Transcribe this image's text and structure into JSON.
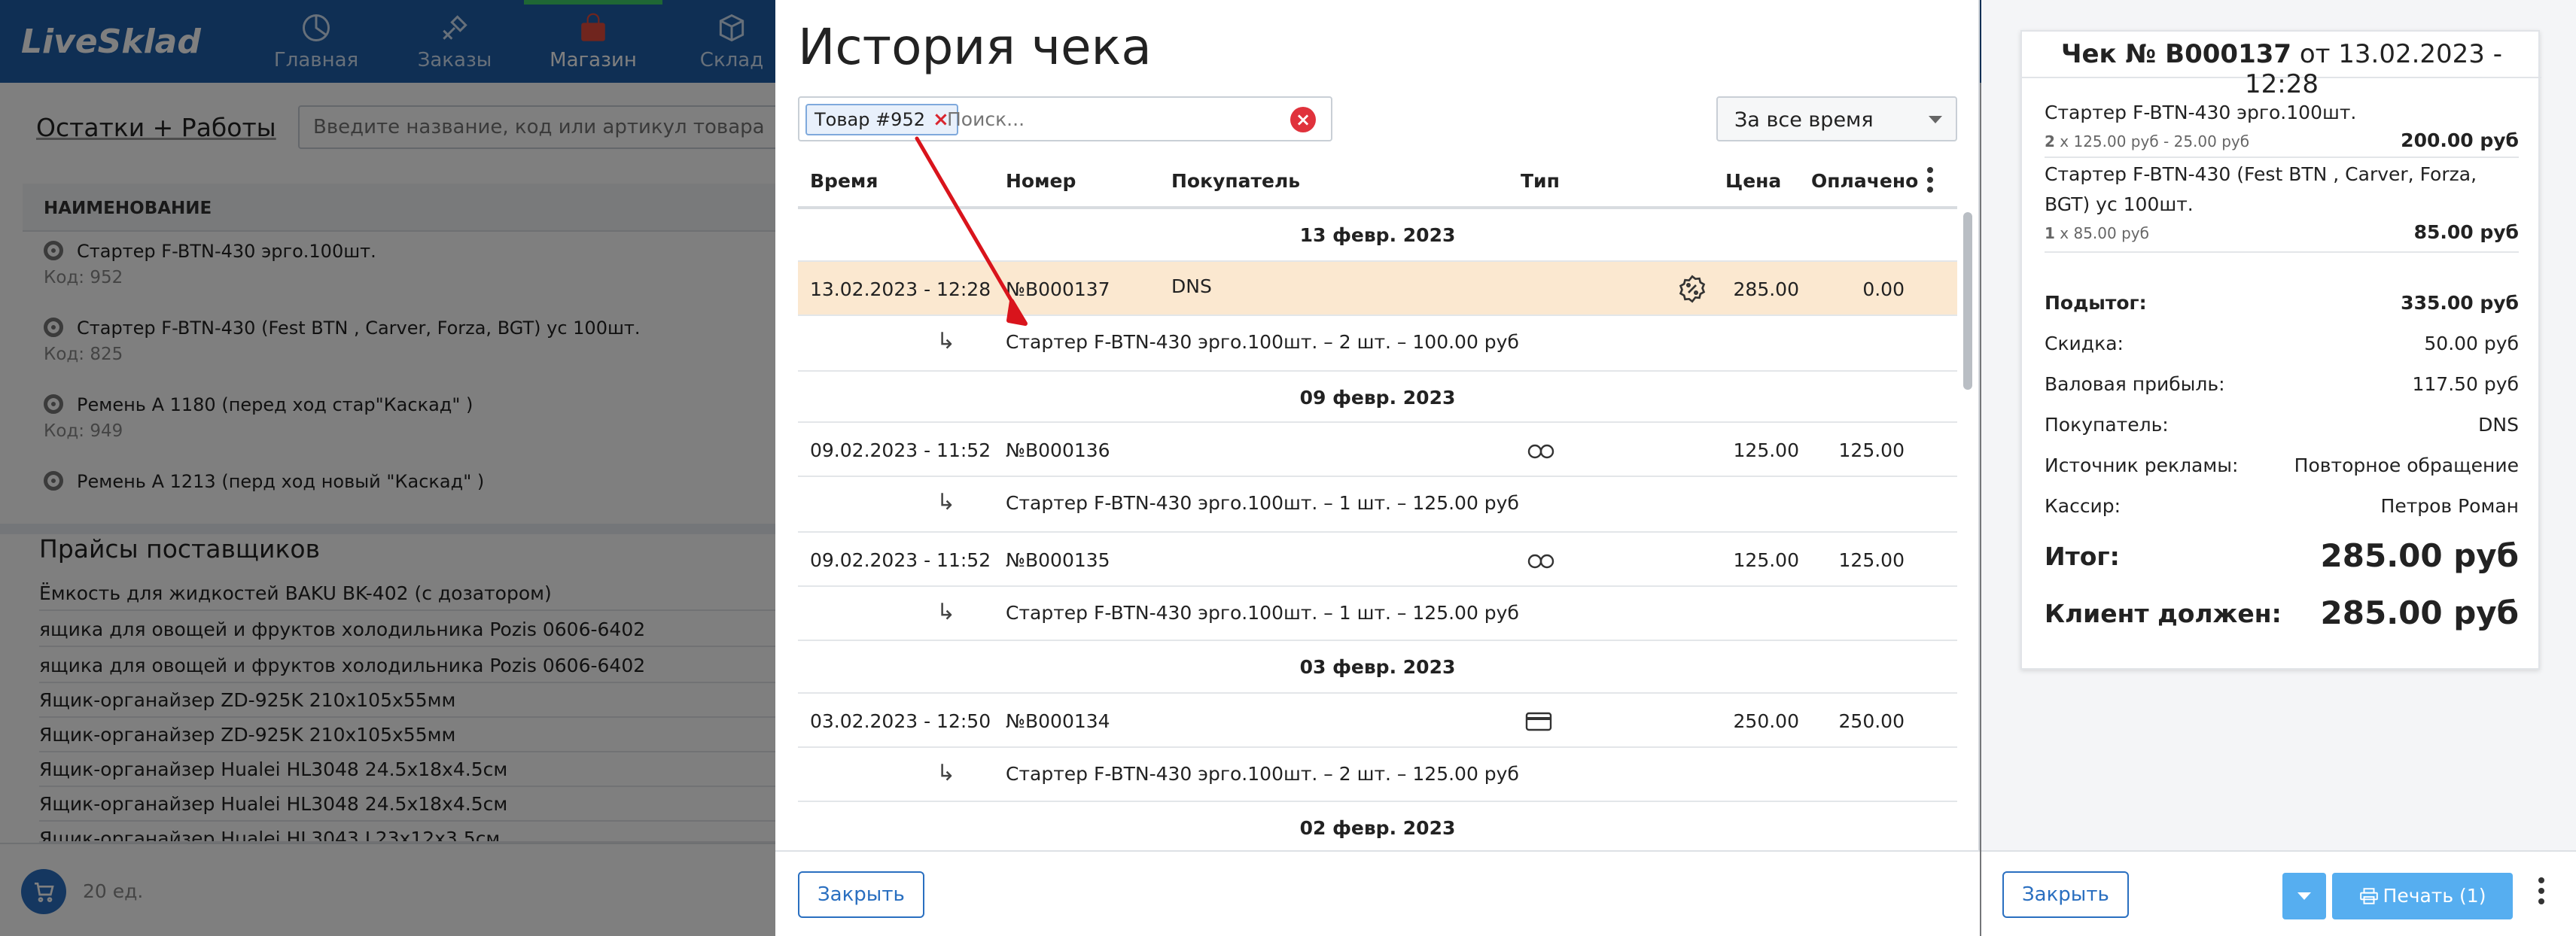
{
  "app": {
    "logo": "LiveSklad",
    "nav": [
      {
        "label": "Главная",
        "icon": "pie-chart-icon"
      },
      {
        "label": "Заказы",
        "icon": "tools-icon"
      },
      {
        "label": "Магазин",
        "icon": "shopping-bag-icon"
      },
      {
        "label": "Склад",
        "icon": "box-icon"
      }
    ]
  },
  "left_panel": {
    "section_title": "Остатки + Работы",
    "search_placeholder": "Введите название, код или артикул товара",
    "column_header": "НАИМЕНОВАНИЕ",
    "items": [
      {
        "name": "Стартер F-BTN-430 эрго.100шт.",
        "code": "Код: 952"
      },
      {
        "name": "Стартер F-BTN-430 (Fest BTN , Carver, Forza, BGT) ус 100шт.",
        "code": "Код: 825"
      },
      {
        "name": "Ремень А 1180 (перед ход стар\"Каскад\" )",
        "code": "Код: 949"
      },
      {
        "name": "Ремень А 1213 (перд ход новый \"Каскад\" )",
        "code": ""
      }
    ],
    "price_title": "Прайсы поставщиков",
    "price_rows": [
      "Ёмкость для жидкостей BAKU BK-402 (с дозатором)",
      "ящика для овощей и фруктов холодильника Pozis 0606-6402",
      "ящика для овощей и фруктов холодильника Pozis 0606-6402",
      "Ящик-органайзер ZD-925K 210x105x55мм",
      "Ящик-органайзер ZD-925K 210x105x55мм",
      "Ящик-органайзер Hualei HL3048 24.5x18x4.5см",
      "Ящик-органайзер Hualei HL3048 24.5x18x4.5см",
      "Ящик-органайзер Hualei HL3043 L23x12x3.5см"
    ],
    "cart_count": "20 ед."
  },
  "history": {
    "title": "История чека",
    "tag_label": "Товар #952",
    "search_placeholder": "Поиск...",
    "period": "За все время",
    "columns": {
      "time": "Время",
      "number": "Номер",
      "buyer": "Покупатель",
      "type": "Тип",
      "price": "Цена",
      "paid": "Оплачено"
    },
    "groups": [
      {
        "date": "13 февр. 2023",
        "time": "13.02.2023 - 12:28",
        "number": "№B000137",
        "buyer": "DNS",
        "type_icon": "discount-icon",
        "price": "285.00",
        "paid": "0.00",
        "detail": "Стартер F-BTN-430 эрго.100шт. – 2 шт. – 100.00 руб"
      },
      {
        "date": "09 февр. 2023",
        "time": "09.02.2023 - 11:52",
        "number": "№B000136",
        "buyer": "",
        "type_icon": "cash-icon",
        "price": "125.00",
        "paid": "125.00",
        "detail": "Стартер F-BTN-430 эрго.100шт. – 1 шт. – 125.00 руб"
      },
      {
        "date": "",
        "time": "09.02.2023 - 11:52",
        "number": "№B000135",
        "buyer": "",
        "type_icon": "cash-icon",
        "price": "125.00",
        "paid": "125.00",
        "detail": "Стартер F-BTN-430 эрго.100шт. – 1 шт. – 125.00 руб"
      },
      {
        "date": "03 февр. 2023",
        "time": "03.02.2023 - 12:50",
        "number": "№B000134",
        "buyer": "",
        "type_icon": "card-icon",
        "price": "250.00",
        "paid": "250.00",
        "detail": "Стартер F-BTN-430 эрго.100шт. – 2 шт. – 125.00 руб"
      },
      {
        "date": "02 февр. 2023"
      }
    ],
    "detail_arrow": "↳",
    "close_label": "Закрыть"
  },
  "receipt": {
    "title_bold": "Чек № B000137",
    "title_rest": " от 13.02.2023 - 12:28",
    "items": [
      {
        "name": "Стартер F-BTN-430 эрго.100шт.",
        "qty_bold": "2",
        "qty_rest": " x 125.00 руб - 25.00 руб",
        "sum": "200.00 руб"
      },
      {
        "name": "Стартер F-BTN-430 (Fest BTN , Carver, Forza, BGT) ус 100шт.",
        "qty_bold": "1",
        "qty_rest": " x 85.00 руб",
        "sum": "85.00 руб"
      }
    ],
    "lines": [
      {
        "label": "Подытог:",
        "value": "335.00 руб",
        "bold": true
      },
      {
        "label": "Скидка:",
        "value": "50.00 руб",
        "bold": false
      },
      {
        "label": "Валовая прибыль:",
        "value": "117.50 руб",
        "bold": false
      },
      {
        "label": "Покупатель:",
        "value": "DNS",
        "bold": false
      },
      {
        "label": "Источник рекламы:",
        "value": "Повторное обращение",
        "bold": false
      },
      {
        "label": "Кассир:",
        "value": "Петров Роман",
        "bold": false
      }
    ],
    "total_label": "Итог:",
    "total_value": "285.00 руб",
    "due_label": "Клиент должен:",
    "due_value": "285.00 руб",
    "close_label": "Закрыть",
    "print_label": "Печать (1)"
  },
  "colors": {
    "accent": "#2a6fc0",
    "selected_row": "#fbe8d0",
    "annotation_arrow": "#d9141c",
    "print_button": "#56aef0"
  }
}
